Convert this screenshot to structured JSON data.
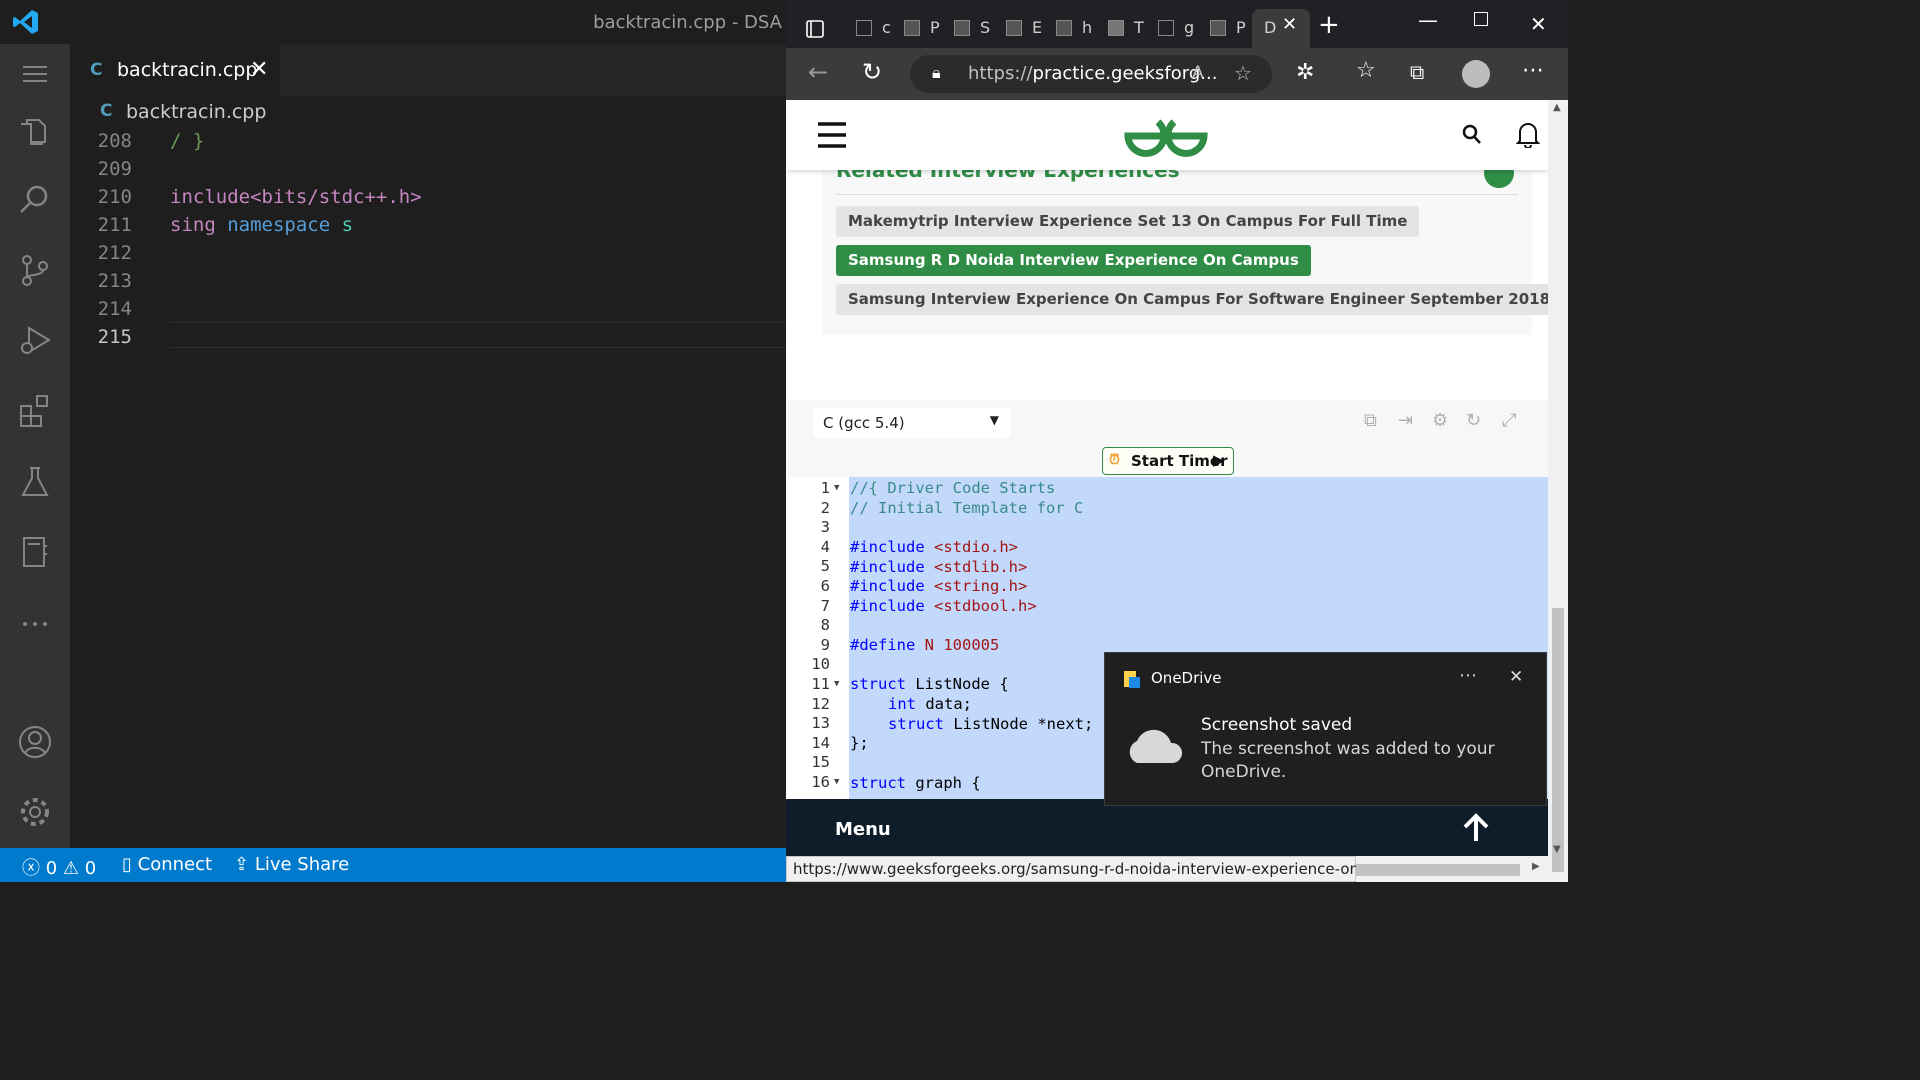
{
  "vscode": {
    "window_title": "backtracin.cpp - DSA",
    "tab": {
      "label": "backtracin.cpp",
      "icon": "C"
    },
    "breadcrumb": "backtracin.cpp",
    "lines": [
      {
        "num": "208",
        "text": "/ }",
        "color": "#6a9955"
      },
      {
        "num": "209",
        "text": "",
        "color": "#d4d4d4"
      },
      {
        "num": "210",
        "text": "include<bits/stdc++.h>",
        "color": "#c586c0"
      },
      {
        "num": "211",
        "text": "sing namespace s",
        "color": "#c586c0"
      },
      {
        "num": "212",
        "text": "",
        "color": "#d4d4d4"
      },
      {
        "num": "213",
        "text": "",
        "color": "#d4d4d4"
      },
      {
        "num": "214",
        "text": "",
        "color": "#d4d4d4"
      },
      {
        "num": "215",
        "text": "",
        "color": "#d4d4d4"
      }
    ],
    "status": {
      "errors": "0",
      "warnings": "0",
      "connect": "Connect",
      "live_share": "Live Share"
    }
  },
  "browser": {
    "tabs": [
      "c",
      "P",
      "S",
      "E",
      "h",
      "T",
      "g",
      "P",
      "D"
    ],
    "url_prefix": "https://",
    "url_rest": "practice.geeksforg...",
    "related_heading": "Related Interview Experiences",
    "related_links": [
      "Makemytrip Interview Experience Set 13 On Campus For Full Time",
      "Samsung R D Noida Interview Experience On Campus",
      "Samsung Interview Experience On Campus For Software Engineer September 2018"
    ],
    "language": "C (gcc 5.4)",
    "timer_label": "Start Timer",
    "code_lines": [
      {
        "n": "1",
        "fold": true
      },
      {
        "n": "2"
      },
      {
        "n": "3"
      },
      {
        "n": "4"
      },
      {
        "n": "5"
      },
      {
        "n": "6"
      },
      {
        "n": "7"
      },
      {
        "n": "8"
      },
      {
        "n": "9"
      },
      {
        "n": "10"
      },
      {
        "n": "11",
        "fold": true
      },
      {
        "n": "12"
      },
      {
        "n": "13"
      },
      {
        "n": "14"
      },
      {
        "n": "15"
      },
      {
        "n": "16",
        "fold": true
      }
    ],
    "code": {
      "l1": "//{ Driver Code Starts",
      "l2": "// Initial Template for C",
      "l4a": "#include",
      "l4b": "<stdio.h>",
      "l5a": "#include",
      "l5b": "<stdlib.h>",
      "l6a": "#include",
      "l6b": "<string.h>",
      "l7a": "#include",
      "l7b": "<stdbool.h>",
      "l9a": "#define",
      "l9b": "N 100005",
      "l11a": "struct",
      "l11b": " ListNode {",
      "l12a": "int",
      "l12b": " data;",
      "l13a": "struct",
      "l13b": " ListNode ",
      "l13c": "*next;",
      "l14": "};",
      "l16a": "struct",
      "l16b": " graph {"
    },
    "menu_label": "Menu",
    "status_url": "https://www.geeksforgeeks.org/samsung-r-d-noida-interview-experience-on-campus/"
  },
  "toast": {
    "app": "OneDrive",
    "title": "Screenshot saved",
    "body": "The screenshot was added to your OneDrive."
  }
}
